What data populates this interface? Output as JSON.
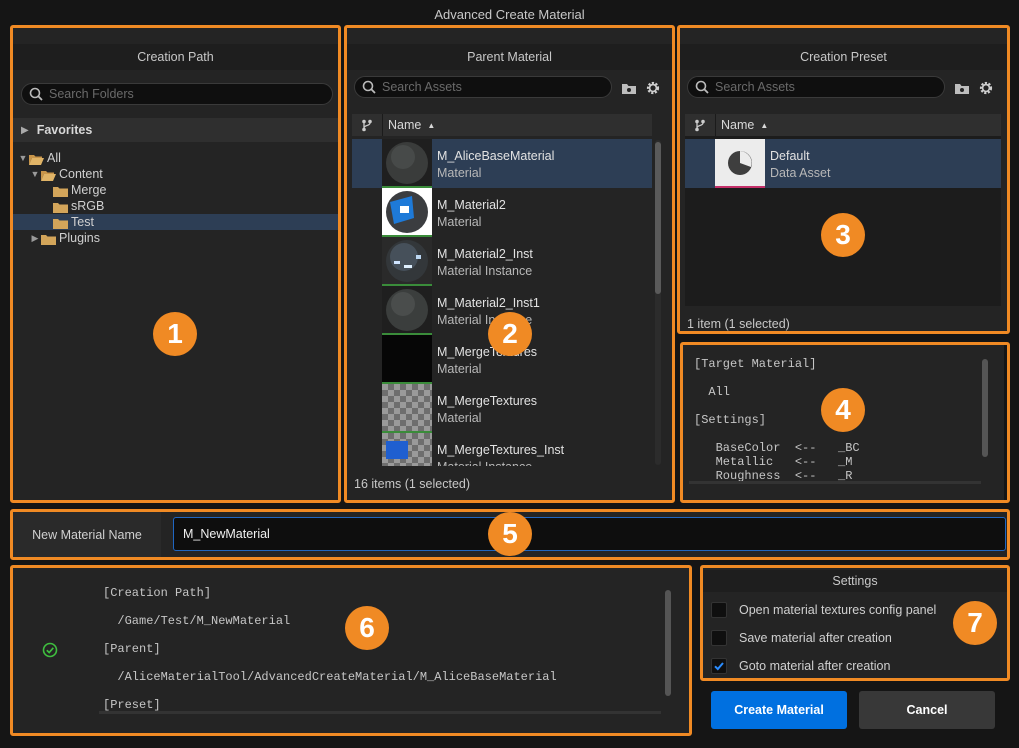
{
  "window": {
    "title": "Advanced Create Material"
  },
  "creation_path": {
    "header": "Creation Path",
    "search_placeholder": "Search Folders",
    "favorites_label": "Favorites",
    "tree": [
      {
        "label": "All",
        "level": 0,
        "expanded": true,
        "selected": false
      },
      {
        "label": "Content",
        "level": 1,
        "expanded": true,
        "selected": false
      },
      {
        "label": "Merge",
        "level": 2,
        "expanded": false,
        "selected": false
      },
      {
        "label": "sRGB",
        "level": 2,
        "expanded": false,
        "selected": false
      },
      {
        "label": "Test",
        "level": 2,
        "expanded": false,
        "selected": true
      },
      {
        "label": "Plugins",
        "level": 1,
        "expanded": false,
        "selected": false
      }
    ],
    "badge": "1"
  },
  "parent_material": {
    "header": "Parent Material",
    "search_placeholder": "Search Assets",
    "column_name": "Name",
    "assets": [
      {
        "name": "M_AliceBaseMaterial",
        "type": "Material",
        "selected": true
      },
      {
        "name": "M_Material2",
        "type": "Material",
        "selected": false
      },
      {
        "name": "M_Material2_Inst",
        "type": "Material Instance",
        "selected": false
      },
      {
        "name": "M_Material2_Inst1",
        "type": "Material Instance",
        "selected": false
      },
      {
        "name": "M_MergeTextures",
        "type": "Material",
        "selected": false
      },
      {
        "name": "M_MergeTextures",
        "type": "Material",
        "selected": false
      },
      {
        "name": "M_MergeTextures_Inst",
        "type": "Material Instance",
        "selected": false
      }
    ],
    "status": "16 items (1 selected)",
    "badge": "2"
  },
  "creation_preset": {
    "header": "Creation Preset",
    "search_placeholder": "Search Assets",
    "column_name": "Name",
    "assets": [
      {
        "name": "Default",
        "type": "Data Asset",
        "selected": true
      }
    ],
    "status": "1 item (1 selected)",
    "badge": "3"
  },
  "preset_details": {
    "lines": [
      "[Target Material]",
      "",
      "  All",
      "",
      "[Settings]",
      "",
      "   BaseColor  <--   _BC",
      "   Metallic   <--   _M",
      "   Roughness  <--   _R"
    ],
    "badge": "4"
  },
  "name_row": {
    "label": "New Material Name",
    "value": "M_NewMaterial",
    "badge": "5"
  },
  "summary": {
    "lines": [
      "[Creation Path]",
      "",
      "  /Game/Test/M_NewMaterial",
      "",
      "[Parent]",
      "",
      "  /AliceMaterialTool/AdvancedCreateMaterial/M_AliceBaseMaterial",
      "",
      "[Preset]"
    ],
    "status_icon": "check-circle-icon",
    "badge": "6"
  },
  "settings": {
    "header": "Settings",
    "options": [
      {
        "label": "Open material textures config panel",
        "checked": false
      },
      {
        "label": "Save material after creation",
        "checked": false
      },
      {
        "label": "Goto material after creation",
        "checked": true
      }
    ],
    "badge": "7"
  },
  "actions": {
    "create_label": "Create Material",
    "cancel_label": "Cancel"
  },
  "colors": {
    "highlight": "#f08a24",
    "accent": "#0070e0",
    "selection": "#2d3e55",
    "ok": "#3fbf3f"
  }
}
